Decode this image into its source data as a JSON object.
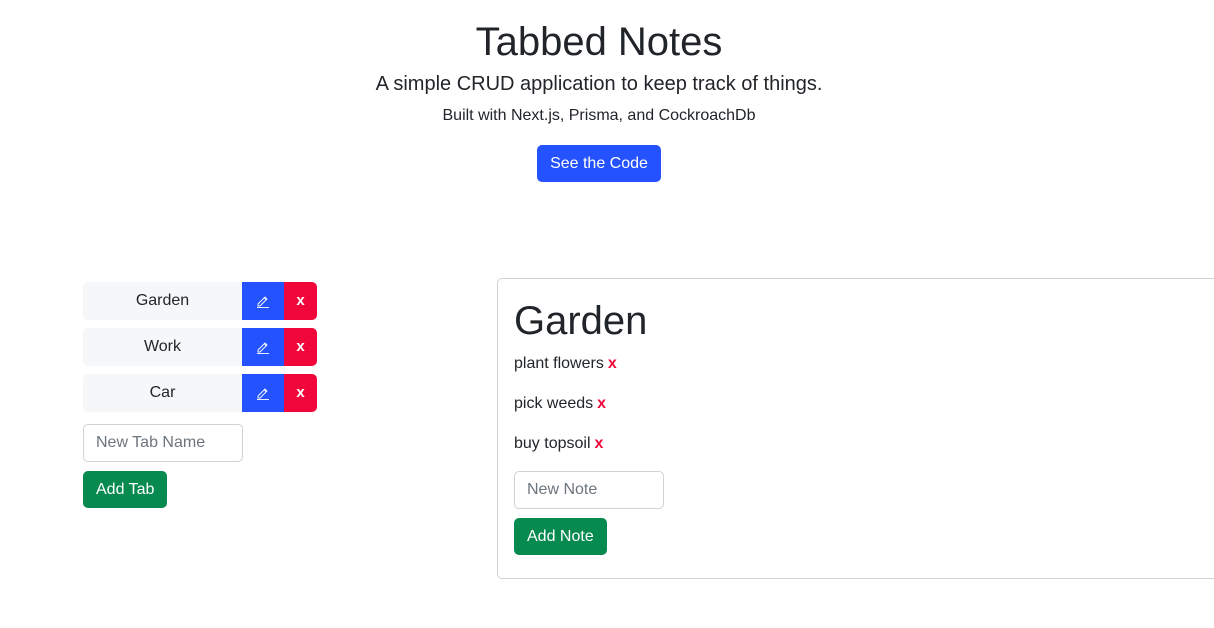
{
  "header": {
    "title": "Tabbed Notes",
    "subtitle": "A simple CRUD application to keep track of things.",
    "built_with": "Built with Next.js, Prisma, and CockroachDb",
    "code_button": "See the Code"
  },
  "tabs": {
    "items": [
      {
        "label": "Garden",
        "delete_label": "x"
      },
      {
        "label": "Work",
        "delete_label": "x"
      },
      {
        "label": "Car",
        "delete_label": "x"
      }
    ],
    "new_tab_input": {
      "value": "",
      "placeholder": "New Tab Name"
    },
    "add_button": "Add Tab"
  },
  "notes": {
    "title": "Garden",
    "items": [
      {
        "text": "plant flowers",
        "delete_label": "x"
      },
      {
        "text": "pick weeds",
        "delete_label": "x"
      },
      {
        "text": "buy topsoil",
        "delete_label": "x"
      }
    ],
    "new_note_input": {
      "value": "",
      "placeholder": "New Note"
    },
    "add_button": "Add Note"
  },
  "colors": {
    "primary": "#2452ff",
    "danger": "#f0063a",
    "success": "#068a4f"
  },
  "icons": {
    "edit": "pencil-icon"
  }
}
